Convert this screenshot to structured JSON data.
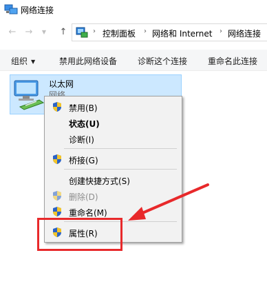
{
  "window": {
    "title": "网络连接"
  },
  "nav": {
    "back_icon": "back-arrow-icon",
    "forward_icon": "forward-arrow-icon",
    "up_icon": "up-arrow-icon",
    "breadcrumb": [
      "控制面板",
      "网络和 Internet",
      "网络连接"
    ]
  },
  "toolbar": {
    "organize": "组织",
    "disable_device": "禁用此网络设备",
    "diagnose": "诊断这个连接",
    "rename": "重命名此连接"
  },
  "connection": {
    "name": "以太网",
    "status": "网络"
  },
  "context_menu": {
    "items": [
      {
        "label": "禁用(B)",
        "icon": "shield-icon",
        "bold": false,
        "disabled": false
      },
      {
        "label": "状态(U)",
        "icon": "",
        "bold": true,
        "disabled": false
      },
      {
        "label": "诊断(I)",
        "icon": "",
        "bold": false,
        "disabled": false
      },
      {
        "label": "桥接(G)",
        "icon": "shield-icon",
        "bold": false,
        "disabled": false
      },
      {
        "label": "创建快捷方式(S)",
        "icon": "",
        "bold": false,
        "disabled": false
      },
      {
        "label": "删除(D)",
        "icon": "shield-icon",
        "bold": false,
        "disabled": true
      },
      {
        "label": "重命名(M)",
        "icon": "shield-icon",
        "bold": false,
        "disabled": false
      },
      {
        "label": "属性(R)",
        "icon": "shield-icon",
        "bold": false,
        "disabled": false
      }
    ]
  },
  "colors": {
    "selection_fill": "#cce8ff",
    "selection_border": "#99d1ff",
    "menu_bg": "#f2f2f2",
    "highlight_red": "#e8292b",
    "shield_blue": "#2b63c6",
    "shield_yellow": "#f3c52a"
  }
}
